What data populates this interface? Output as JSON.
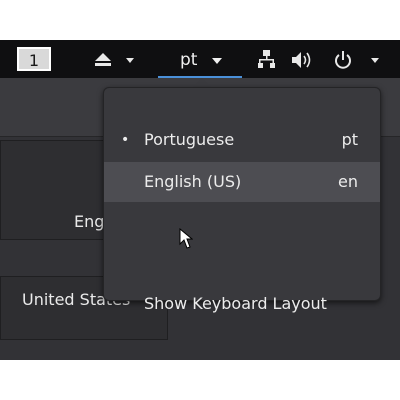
{
  "topbar": {
    "workspace": "1",
    "language_code": "pt"
  },
  "background": {
    "field_text_1": "Eng",
    "field_text_2": "United States"
  },
  "menu": {
    "items": [
      {
        "label": "Portuguese",
        "code": "pt",
        "selected": true
      },
      {
        "label": "English (US)",
        "code": "en",
        "selected": false
      }
    ],
    "show_layout_label": "Show Keyboard Layout",
    "bullet": "•"
  },
  "colors": {
    "topbar_bg": "#0f0f11",
    "menu_bg": "#39393d",
    "hover_bg": "#4d4d52",
    "accent_underline": "#4a90d9"
  },
  "icons": [
    "eject-icon",
    "dropdown-arrow-icon",
    "network-icon",
    "volume-icon",
    "power-icon",
    "mouse-cursor-icon"
  ]
}
